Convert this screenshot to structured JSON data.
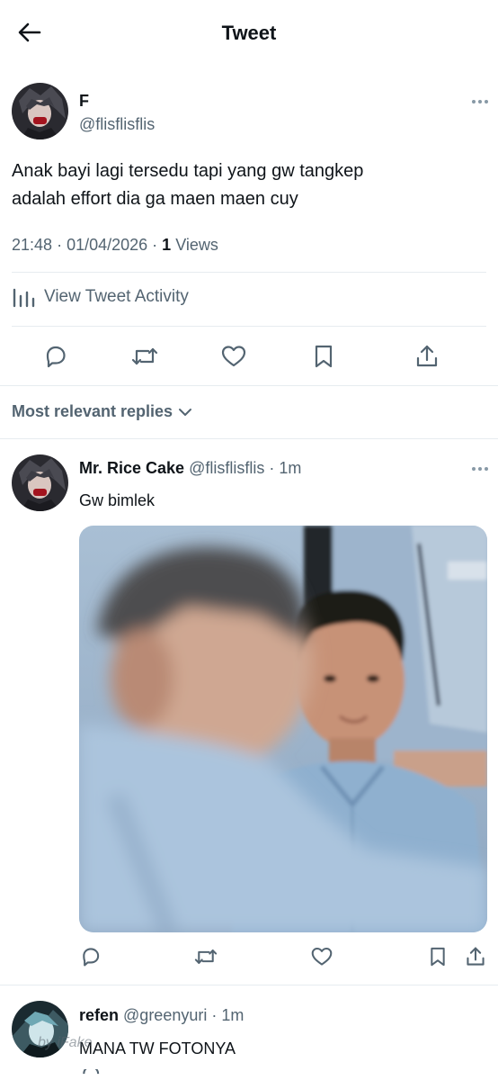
{
  "header": {
    "title": "Tweet",
    "back_icon": "arrow-left-icon"
  },
  "tweet": {
    "author_name": "F",
    "author_handle": "@flisflisflis",
    "text_line1": "Anak bayi lagi tersedu tapi yang gw tangkep",
    "text_line2": "adalah effort dia ga maen maen cuy",
    "time": "21:48",
    "date": "01/04/2026",
    "views_count": "1",
    "views_label": "Views",
    "activity_label": "View Tweet Activity"
  },
  "actions": [
    "reply-icon",
    "retweet-icon",
    "like-icon",
    "bookmark-icon",
    "share-icon"
  ],
  "replies_header": {
    "label": "Most relevant replies"
  },
  "replies": [
    {
      "name": "Mr. Rice Cake",
      "handle": "@flisflisflis",
      "time": "1m",
      "text": "Gw bimlek",
      "has_photo": true
    },
    {
      "name": "refen",
      "handle": "@greenyuri",
      "time": "1m",
      "text": "MANA TW FOTONYA"
    }
  ],
  "watermark": "by iFake",
  "colors": {
    "text": "#0f1419",
    "secondary": "#536471",
    "divider": "#e6ecf0",
    "icon": "#536471"
  }
}
